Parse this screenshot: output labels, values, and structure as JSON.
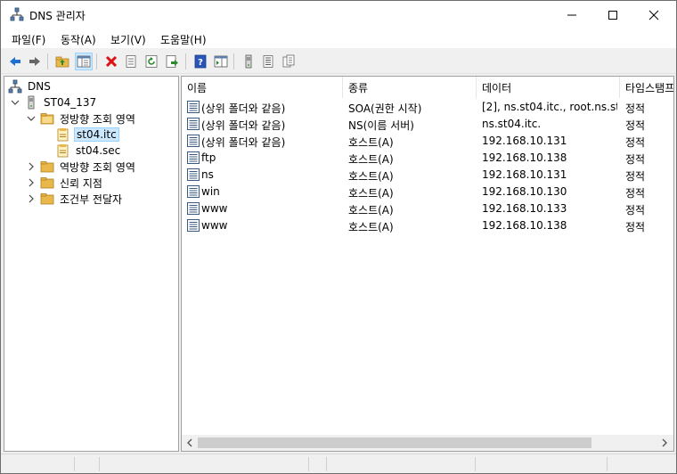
{
  "window": {
    "title": "DNS 관리자"
  },
  "menu": [
    "파일(F)",
    "동작(A)",
    "보기(V)",
    "도움말(H)"
  ],
  "toolbar": {
    "buttons": [
      "back-icon",
      "forward-icon",
      "up-folder-icon",
      "show-hide-tree-icon",
      "delete-icon",
      "properties-icon",
      "refresh-icon",
      "export-icon",
      "help-icon",
      "console-icon",
      "server-icon",
      "list-icon",
      "copy-icon"
    ]
  },
  "tree": {
    "root": "DNS",
    "server": "ST04_137",
    "forward_zone": "정방향 조회 영역",
    "zone_itc": "st04.itc",
    "zone_sec": "st04.sec",
    "reverse_zone": "역방향 조회 영역",
    "trust_points": "신뢰 지점",
    "conditional_forwarders": "조건부 전달자"
  },
  "list": {
    "columns": [
      "이름",
      "종류",
      "데이터",
      "타임스탬프"
    ],
    "rows": [
      {
        "name": "(상위 폴더와 같음)",
        "type": "SOA(권한 시작)",
        "data": "[2], ns.st04.itc., root.ns.st...",
        "timestamp": "정적"
      },
      {
        "name": "(상위 폴더와 같음)",
        "type": "NS(이름 서버)",
        "data": "ns.st04.itc.",
        "timestamp": "정적"
      },
      {
        "name": "(상위 폴더와 같음)",
        "type": "호스트(A)",
        "data": "192.168.10.131",
        "timestamp": "정적"
      },
      {
        "name": "ftp",
        "type": "호스트(A)",
        "data": "192.168.10.138",
        "timestamp": "정적"
      },
      {
        "name": "ns",
        "type": "호스트(A)",
        "data": "192.168.10.131",
        "timestamp": "정적"
      },
      {
        "name": "win",
        "type": "호스트(A)",
        "data": "192.168.10.130",
        "timestamp": "정적"
      },
      {
        "name": "www",
        "type": "호스트(A)",
        "data": "192.168.10.133",
        "timestamp": "정적"
      },
      {
        "name": "www",
        "type": "호스트(A)",
        "data": "192.168.10.138",
        "timestamp": "정적"
      }
    ]
  },
  "colors": {
    "selection": "#cce8ff",
    "folder": "#e8b84a",
    "accent": "#1e6fd0"
  }
}
